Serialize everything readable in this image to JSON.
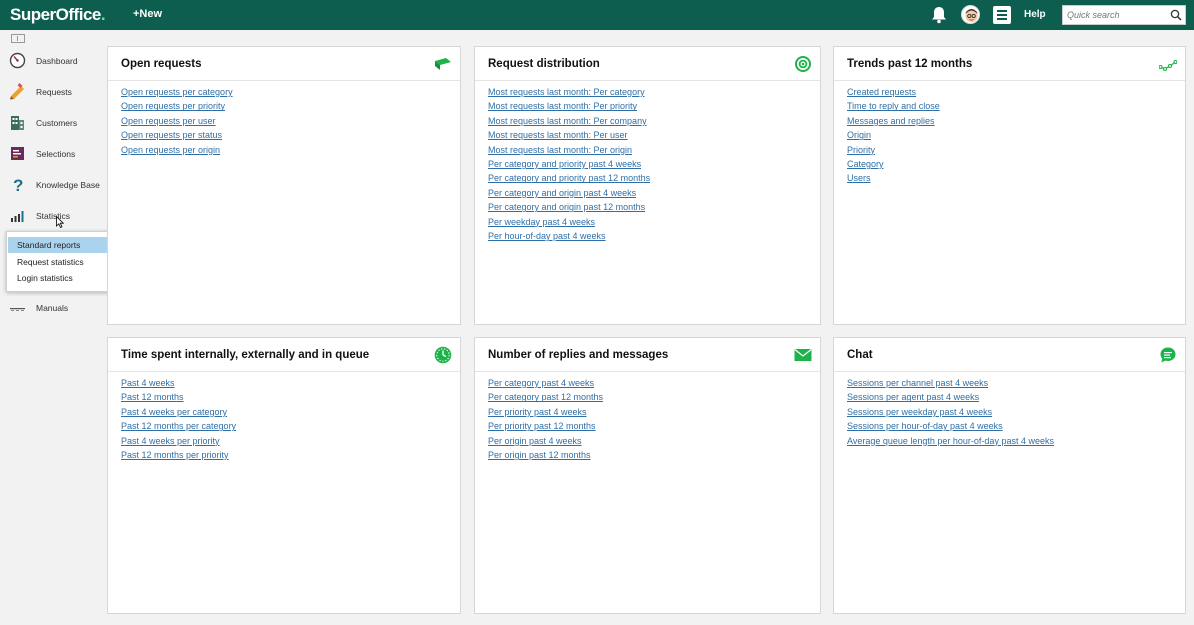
{
  "topbar": {
    "logo_text": "SuperOffice",
    "logo_dot": ".",
    "new_label": "+New",
    "help_label": "Help",
    "search_placeholder": "Quick search"
  },
  "sidebar": {
    "items": [
      {
        "label": "Dashboard",
        "icon": "dashboard-icon"
      },
      {
        "label": "Requests",
        "icon": "requests-icon"
      },
      {
        "label": "Customers",
        "icon": "customers-icon"
      },
      {
        "label": "Selections",
        "icon": "selections-icon"
      },
      {
        "label": "Knowledge Base",
        "icon": "question-icon"
      },
      {
        "label": "Statistics",
        "icon": "statistics-icon"
      },
      {
        "label": "Manuals",
        "icon": "manuals-icon"
      }
    ],
    "popup": [
      "Standard reports",
      "Request statistics",
      "Login statistics"
    ]
  },
  "cards": [
    {
      "title": "Open requests",
      "icon": "flag-icon",
      "links": [
        "Open requests per category",
        "Open requests per priority",
        "Open requests per user",
        "Open requests per status",
        "Open requests per origin"
      ]
    },
    {
      "title": "Request distribution",
      "icon": "target-icon",
      "links": [
        "Most requests last month: Per category",
        "Most requests last month: Per priority",
        "Most requests last month: Per company",
        "Most requests last month: Per user",
        "Most requests last month: Per origin",
        "Per category and priority past 4 weeks",
        "Per category and priority past 12 months",
        "Per category and origin past 4 weeks",
        "Per category and origin past 12 months",
        "Per weekday past 4 weeks",
        "Per hour-of-day past 4 weeks"
      ]
    },
    {
      "title": "Trends past 12 months",
      "icon": "trend-icon",
      "links": [
        "Created requests",
        "Time to reply and close",
        "Messages and replies",
        "Origin",
        "Priority",
        "Category",
        "Users"
      ]
    },
    {
      "title": "Time spent internally, externally and in queue",
      "icon": "clock-icon",
      "links": [
        "Past 4 weeks",
        "Past 12 months",
        "Past 4 weeks per category",
        "Past 12 months per category",
        "Past 4 weeks per priority",
        "Past 12 months per priority"
      ]
    },
    {
      "title": "Number of replies and messages",
      "icon": "envelope-icon",
      "links": [
        "Per category past 4 weeks",
        "Per category past 12 months",
        "Per priority past 4 weeks",
        "Per priority past 12 months",
        "Per origin past 4 weeks",
        "Per origin past 12 months"
      ]
    },
    {
      "title": "Chat",
      "icon": "chat-icon",
      "links": [
        "Sessions per channel past 4 weeks",
        "Sessions per agent past 4 weeks",
        "Sessions per weekday past 4 weeks",
        "Sessions per hour-of-day past 4 weeks",
        "Average queue length per hour-of-day past 4 weeks"
      ]
    }
  ]
}
